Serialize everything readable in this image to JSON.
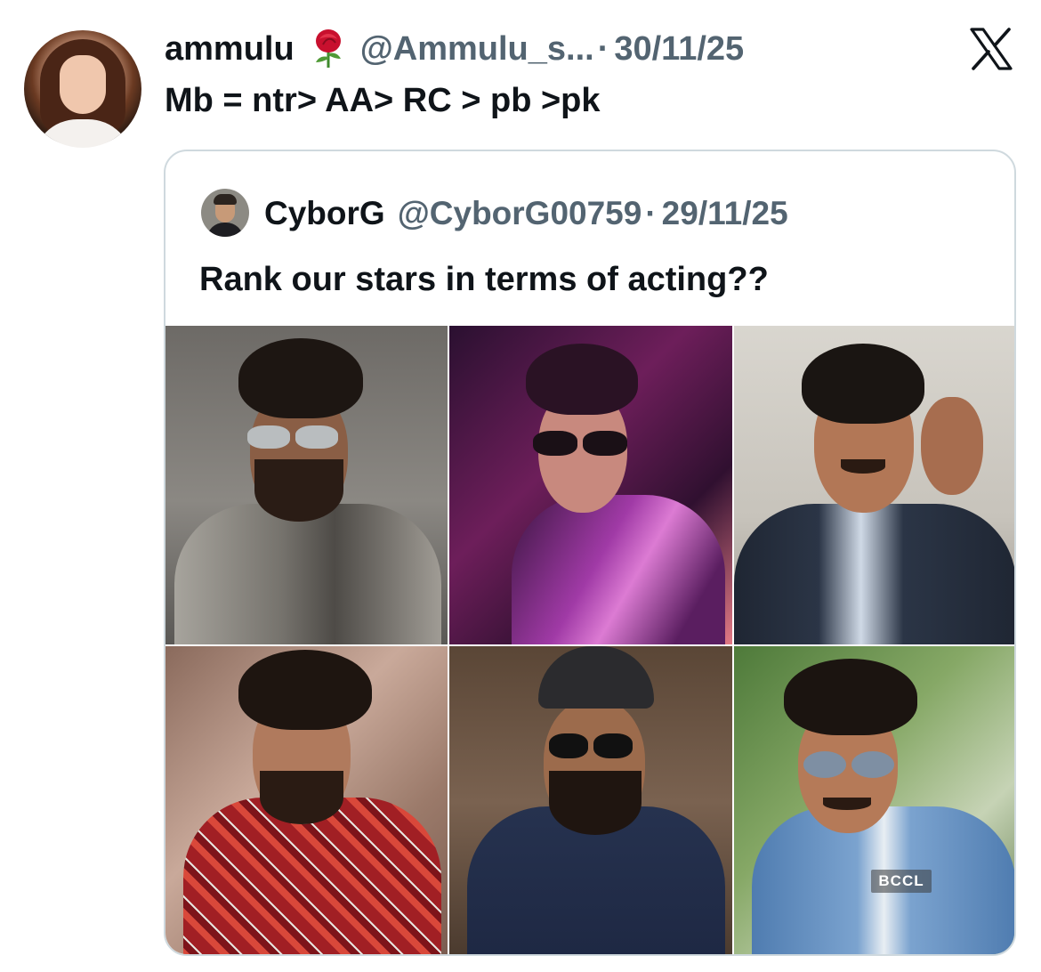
{
  "tweet": {
    "author_name": "ammulu",
    "author_emoji": "rose",
    "author_handle": "@Ammulu_s...",
    "separator": "·",
    "date": "30/11/25",
    "text": "Mb = ntr> AA> RC > pb >pk"
  },
  "quoted_tweet": {
    "author_name": "CyborG",
    "author_handle": "@CyborG00759",
    "separator": "·",
    "date": "29/11/25",
    "text": "Rank our stars in terms of acting??"
  },
  "photo_grid": {
    "watermark": "BCCL"
  },
  "icons": {
    "platform_logo": "x-logo-icon"
  },
  "colors": {
    "primary_text": "#0f1419",
    "secondary_text": "#536471",
    "card_border": "#cfd9de"
  }
}
